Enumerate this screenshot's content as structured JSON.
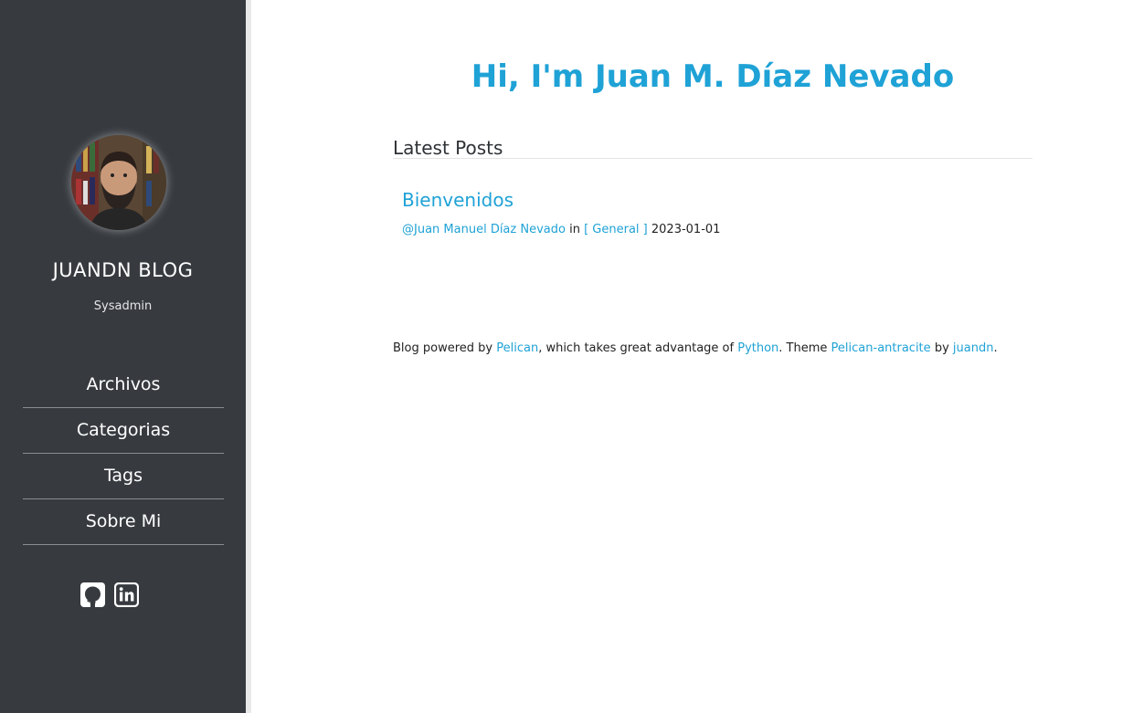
{
  "sidebar": {
    "blog_title": "JUANDN BLOG",
    "subtitle": "Sysadmin",
    "nav": [
      {
        "label": "Archivos"
      },
      {
        "label": "Categorias"
      },
      {
        "label": "Tags"
      },
      {
        "label": "Sobre Mi"
      }
    ],
    "social": [
      {
        "icon": "github-icon"
      },
      {
        "icon": "linkedin-icon"
      }
    ]
  },
  "main": {
    "heading": "Hi, I'm Juan M. Díaz Nevado",
    "section_title": "Latest Posts",
    "posts": [
      {
        "title": "Bienvenidos",
        "author": "@Juan Manuel Díaz Nevado",
        "in_text": "in",
        "category": "[ General ]",
        "date": "2023-01-01"
      }
    ]
  },
  "footer": {
    "prefix": "Blog powered by",
    "pelican": "Pelican",
    "middle": ", which takes great advantage of",
    "python": "Python",
    "theme_text": ". Theme",
    "theme": "Pelican-antracite",
    "by_text": "by",
    "author": "juandn",
    "suffix": "."
  },
  "colors": {
    "sidebar_bg": "#373b40",
    "accent": "#1fa2d6"
  }
}
